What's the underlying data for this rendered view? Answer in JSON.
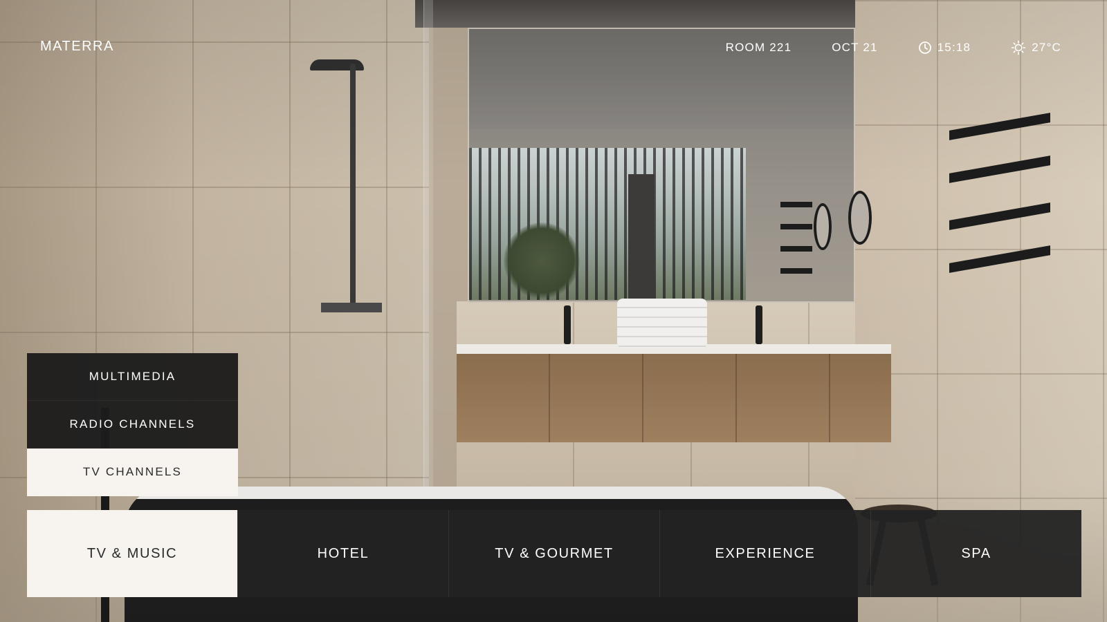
{
  "brand": {
    "name": "MATERRA"
  },
  "status": {
    "room": "ROOM 221",
    "date": "OCT 21",
    "time": "15:18",
    "temperature": "27°C",
    "time_icon": "clock-icon",
    "weather_icon": "sun-icon"
  },
  "submenu": {
    "items": [
      {
        "label": "MULTIMEDIA",
        "active": false
      },
      {
        "label": "RADIO CHANNELS",
        "active": false
      },
      {
        "label": "TV CHANNELS",
        "active": true
      }
    ]
  },
  "main_nav": {
    "items": [
      {
        "label": "TV & MUSIC",
        "active": true
      },
      {
        "label": "HOTEL",
        "active": false
      },
      {
        "label": "TV & GOURMET",
        "active": false
      },
      {
        "label": "EXPERIENCE",
        "active": false
      },
      {
        "label": "SPA",
        "active": false
      }
    ]
  },
  "colors": {
    "menu_dark": "#232323",
    "menu_active": "#f7f4ef",
    "text_light": "#ffffff",
    "text_dark": "#2a2a2a"
  }
}
